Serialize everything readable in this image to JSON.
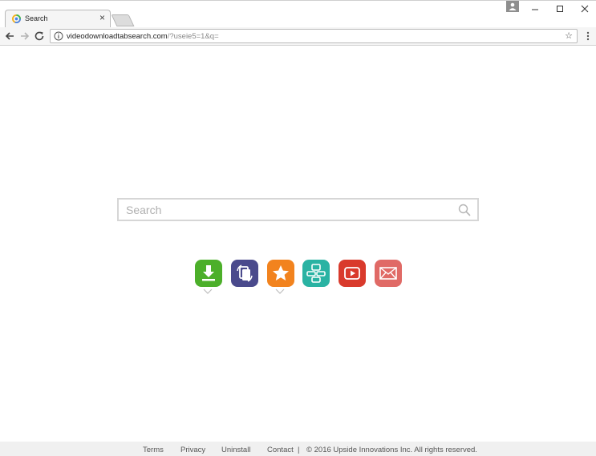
{
  "browser": {
    "tab": {
      "title": "Search"
    },
    "address_bar": {
      "url_host": "videodownloadtabsearch.com",
      "url_rest": "/?useie5=1&q="
    }
  },
  "search": {
    "placeholder": "Search",
    "value": ""
  },
  "apps": [
    {
      "icon": "download-icon",
      "color": "#4caf2a"
    },
    {
      "icon": "convert-icon",
      "color": "#4a4a8c"
    },
    {
      "icon": "star-icon",
      "color": "#f2831e"
    },
    {
      "icon": "tv-icon",
      "color": "#2ab3a3"
    },
    {
      "icon": "youtube-icon",
      "color": "#d93a2c"
    },
    {
      "icon": "mail-icon",
      "color": "#e06a66"
    }
  ],
  "footer": {
    "links": [
      "Terms",
      "Privacy",
      "Uninstall",
      "Contact"
    ],
    "separator": "|",
    "copyright": "© 2016 Upside Innovations Inc. All rights reserved."
  }
}
